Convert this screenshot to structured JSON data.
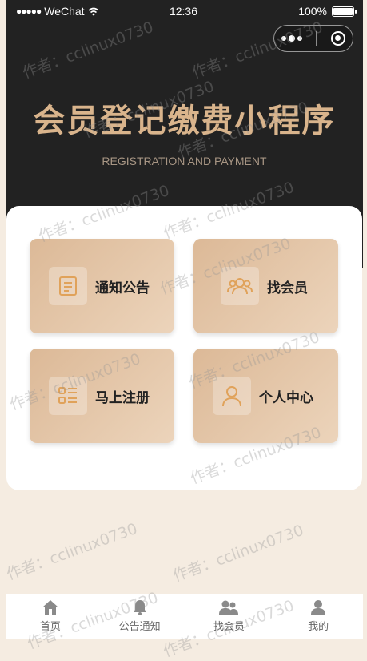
{
  "status_bar": {
    "carrier": "WeChat",
    "time": "12:36",
    "battery": "100%"
  },
  "header": {
    "title": "会员登记缴费小程序",
    "subtitle": "REGISTRATION AND PAYMENT"
  },
  "menu": [
    {
      "label": "通知公告",
      "icon": "notice-icon"
    },
    {
      "label": "找会员",
      "icon": "members-icon"
    },
    {
      "label": "马上注册",
      "icon": "register-icon"
    },
    {
      "label": "个人中心",
      "icon": "profile-icon"
    }
  ],
  "tabbar": [
    {
      "label": "首页",
      "icon": "home-icon"
    },
    {
      "label": "公告通知",
      "icon": "bell-icon"
    },
    {
      "label": "找会员",
      "icon": "group-icon"
    },
    {
      "label": "我的",
      "icon": "user-icon"
    }
  ],
  "watermark": "作者：cclinux0730",
  "colors": {
    "hero_bg": "#222222",
    "title_gold": "#d9b48c",
    "card_gradient_start": "#dcb997",
    "card_gradient_end": "#ecd4bb",
    "icon_stroke": "#e0a25a",
    "page_bg": "#f5ece1"
  }
}
